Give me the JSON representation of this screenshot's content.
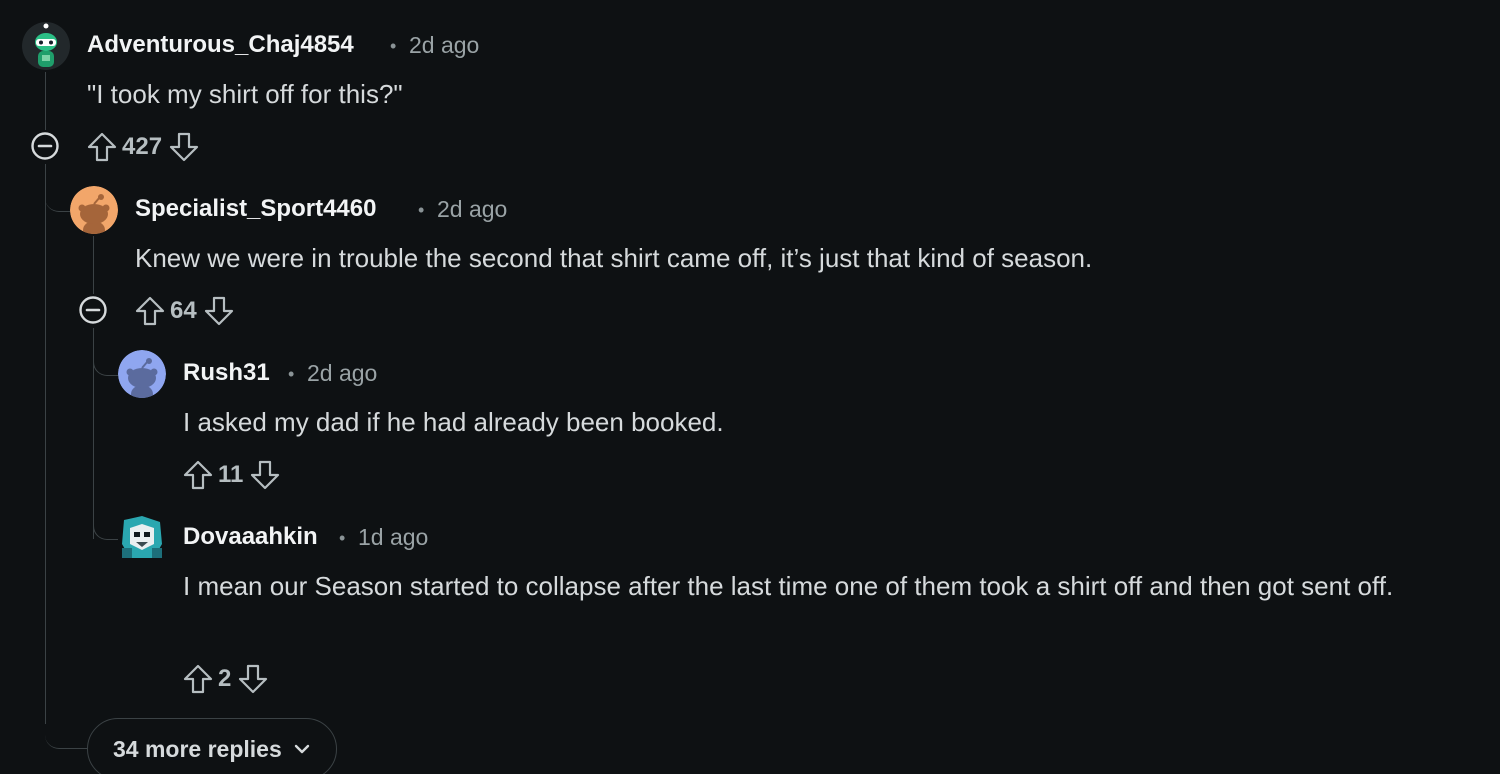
{
  "comments": [
    {
      "author": "Adventurous_Chaj4854",
      "separator": "•",
      "time": "2d ago",
      "body": "\"I took my shirt off for this?\"",
      "votes": "427",
      "avatar_icon": "green-snoo-avatar",
      "avatar_color": "#1f9e6b"
    },
    {
      "author": "Specialist_Sport4460",
      "separator": "•",
      "time": "2d ago",
      "body": "Knew we were in trouble the second that shirt came off, it’s just that kind of season.",
      "votes": "64",
      "avatar_icon": "orange-snoo-avatar",
      "avatar_color": "#f2a66a"
    },
    {
      "author": "Rush31",
      "separator": "•",
      "time": "2d ago",
      "body": "I asked my dad if he had already been booked.",
      "votes": "11",
      "avatar_icon": "blue-snoo-avatar",
      "avatar_color": "#8fa6f0"
    },
    {
      "author": "Dovaaahkin",
      "separator": "•",
      "time": "1d ago",
      "body": "I mean our Season started to collapse after the last time one of them took a shirt off and then got sent off.",
      "votes": "2",
      "avatar_icon": "robot-avatar",
      "avatar_color": "#2aa7b0"
    }
  ],
  "more_replies_label": "34 more replies",
  "colors": {
    "background": "#0e1113",
    "thread_line": "#3b4245",
    "text": "#d6dadc",
    "author": "#f2f4f5",
    "muted": "#9aa3a6"
  }
}
